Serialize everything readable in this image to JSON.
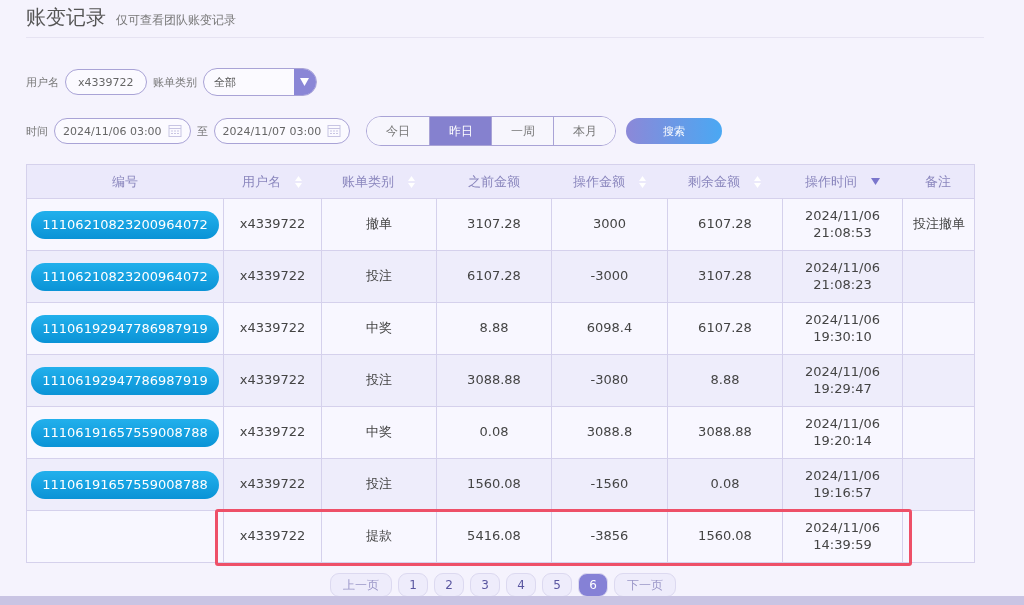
{
  "header": {
    "title": "账变记录",
    "subtitle": "仅可查看团队账变记录"
  },
  "filters": {
    "username_label": "用户名",
    "username": "x4339722",
    "type_label": "账单类别",
    "type_value": "全部",
    "time_label": "时间",
    "start": "2024/11/06 03:00",
    "to_label": "至",
    "end": "2024/11/07 03:00",
    "ranges": [
      {
        "label": "今日",
        "selected": false
      },
      {
        "label": "昨日",
        "selected": true
      },
      {
        "label": "一周",
        "selected": false
      },
      {
        "label": "本月",
        "selected": false
      }
    ],
    "search_button": "搜索"
  },
  "table": {
    "columns": [
      {
        "label": "编号",
        "sortable": false,
        "sorted": false
      },
      {
        "label": "用户名",
        "sortable": true,
        "sorted": false
      },
      {
        "label": "账单类别",
        "sortable": true,
        "sorted": false
      },
      {
        "label": "之前金额",
        "sortable": false,
        "sorted": false
      },
      {
        "label": "操作金额",
        "sortable": true,
        "sorted": false
      },
      {
        "label": "剩余金额",
        "sortable": true,
        "sorted": false
      },
      {
        "label": "操作时间",
        "sortable": false,
        "sorted": true
      },
      {
        "label": "备注",
        "sortable": false,
        "sorted": false
      }
    ],
    "rows": [
      {
        "id": "11106210823200964072",
        "user": "x4339722",
        "type": "撤单",
        "before": "3107.28",
        "amount": "3000",
        "after": "6107.28",
        "date": "2024/11/06",
        "time": "21:08:53",
        "note": "投注撤单",
        "highlighted": false
      },
      {
        "id": "11106210823200964072",
        "user": "x4339722",
        "type": "投注",
        "before": "6107.28",
        "amount": "-3000",
        "after": "3107.28",
        "date": "2024/11/06",
        "time": "21:08:23",
        "highlighted": false
      },
      {
        "id": "11106192947786987919",
        "user": "x4339722",
        "type": "中奖",
        "before": "8.88",
        "amount": "6098.4",
        "after": "6107.28",
        "date": "2024/11/06",
        "time": "19:30:10",
        "highlighted": false
      },
      {
        "id": "11106192947786987919",
        "user": "x4339722",
        "type": "投注",
        "before": "3088.88",
        "amount": "-3080",
        "after": "8.88",
        "date": "2024/11/06",
        "time": "19:29:47",
        "highlighted": false
      },
      {
        "id": "11106191657559008788",
        "user": "x4339722",
        "type": "中奖",
        "before": "0.08",
        "amount": "3088.8",
        "after": "3088.88",
        "date": "2024/11/06",
        "time": "19:20:14",
        "highlighted": false
      },
      {
        "id": "11106191657559008788",
        "user": "x4339722",
        "type": "投注",
        "before": "1560.08",
        "amount": "-1560",
        "after": "0.08",
        "date": "2024/11/06",
        "time": "19:16:57",
        "highlighted": false
      },
      {
        "user": "x4339722",
        "type": "提款",
        "before": "5416.08",
        "amount": "-3856",
        "after": "1560.08",
        "date": "2024/11/06",
        "time": "14:39:59",
        "highlighted": true
      }
    ]
  },
  "pagination": {
    "prev": {
      "label": "上一页",
      "disabled": true
    },
    "pages": [
      {
        "label": "1",
        "selected": false
      },
      {
        "label": "2",
        "selected": false
      },
      {
        "label": "3",
        "selected": false
      },
      {
        "label": "4",
        "selected": false
      },
      {
        "label": "5",
        "selected": false
      },
      {
        "label": "6",
        "selected": true
      }
    ],
    "next": {
      "label": "下一页",
      "disabled": true
    }
  }
}
